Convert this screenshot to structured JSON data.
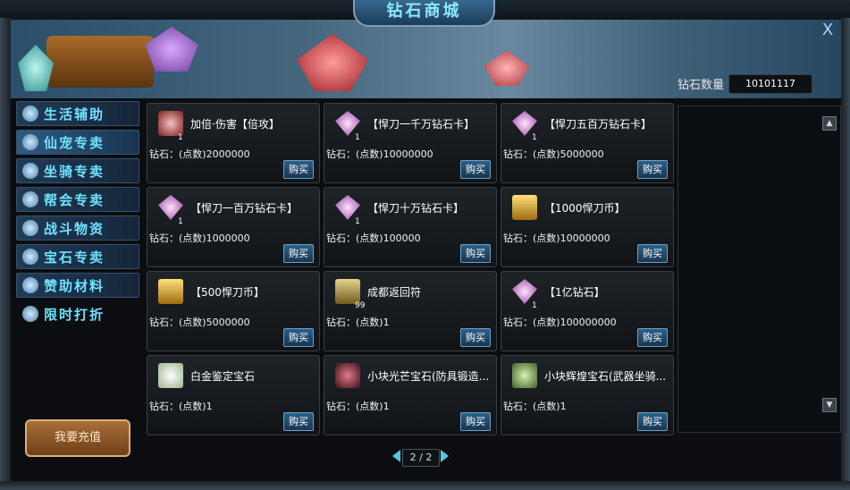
{
  "window": {
    "title": "钻石商城",
    "close_glyph": "X"
  },
  "diamond": {
    "label": "钻石数量",
    "value": "10101117"
  },
  "sidebar": {
    "items": [
      {
        "label": "生活辅助",
        "icon": "pill-icon"
      },
      {
        "label": "仙宠专卖",
        "icon": "paw-icon"
      },
      {
        "label": "坐骑专卖",
        "icon": "horse-icon"
      },
      {
        "label": "帮会专卖",
        "icon": "flag-icon"
      },
      {
        "label": "战斗物资",
        "icon": "box-icon"
      },
      {
        "label": "宝石专卖",
        "icon": "gem-icon"
      },
      {
        "label": "赞助材料",
        "icon": "person-icon"
      },
      {
        "label": "限时打折",
        "icon": "megaphone-icon"
      }
    ],
    "active_index": 1
  },
  "recharge": {
    "label": "我要充值"
  },
  "items": [
    {
      "name": "加倍·伤害【倍攻】",
      "price": "钻石：(点数)2000000",
      "qty": "1",
      "icon": "crossed-swords-icon",
      "color": "#c34040",
      "buy": "购买"
    },
    {
      "name": "【悍刀一千万钻石卡】",
      "price": "钻石：(点数)10000000",
      "qty": "1",
      "icon": "diamond-icon",
      "color": "#d37fd6",
      "buy": "购买"
    },
    {
      "name": "【悍刀五百万钻石卡】",
      "price": "钻石：(点数)5000000",
      "qty": "1",
      "icon": "diamond-icon",
      "color": "#d37fd6",
      "buy": "购买"
    },
    {
      "name": "【悍刀一百万钻石卡】",
      "price": "钻石：(点数)1000000",
      "qty": "1",
      "icon": "diamond-icon",
      "color": "#d37fd6",
      "buy": "购买"
    },
    {
      "name": "【悍刀十万钻石卡】",
      "price": "钻石：(点数)100000",
      "qty": "1",
      "icon": "diamond-icon",
      "color": "#d37fd6",
      "buy": "购买"
    },
    {
      "name": "【1000悍刀币】",
      "price": "钻石：(点数)10000000",
      "qty": "",
      "icon": "gold-coin-icon",
      "color": "#d5a32a",
      "buy": "购买"
    },
    {
      "name": "【500悍刀币】",
      "price": "钻石：(点数)5000000",
      "qty": "",
      "icon": "gold-coin-icon",
      "color": "#d5a32a",
      "buy": "购买"
    },
    {
      "name": "成都返回符",
      "price": "钻石：(点数)1",
      "qty": "99",
      "icon": "scroll-icon",
      "color": "#b7a056",
      "buy": "购买"
    },
    {
      "name": "【1亿钻石】",
      "price": "钻石：(点数)100000000",
      "qty": "1",
      "icon": "diamond-icon",
      "color": "#d37fd6",
      "buy": "购买"
    },
    {
      "name": "白金鉴定宝石",
      "price": "钻石：(点数)1",
      "qty": "",
      "icon": "platinum-gem-icon",
      "color": "#d7e9c6",
      "buy": "购买"
    },
    {
      "name": "小块光芒宝石(防具锻造...",
      "price": "钻石：(点数)1",
      "qty": "",
      "icon": "red-gem-icon",
      "color": "#8a2d3c",
      "buy": "购买"
    },
    {
      "name": "小块辉煌宝石(武器坐骑...",
      "price": "钻石：(点数)1",
      "qty": "",
      "icon": "green-gem-icon",
      "color": "#9ec27a",
      "buy": "购买"
    }
  ],
  "pager": {
    "text": "2 / 2"
  },
  "scroll": {
    "up": "▲",
    "down": "▼"
  }
}
